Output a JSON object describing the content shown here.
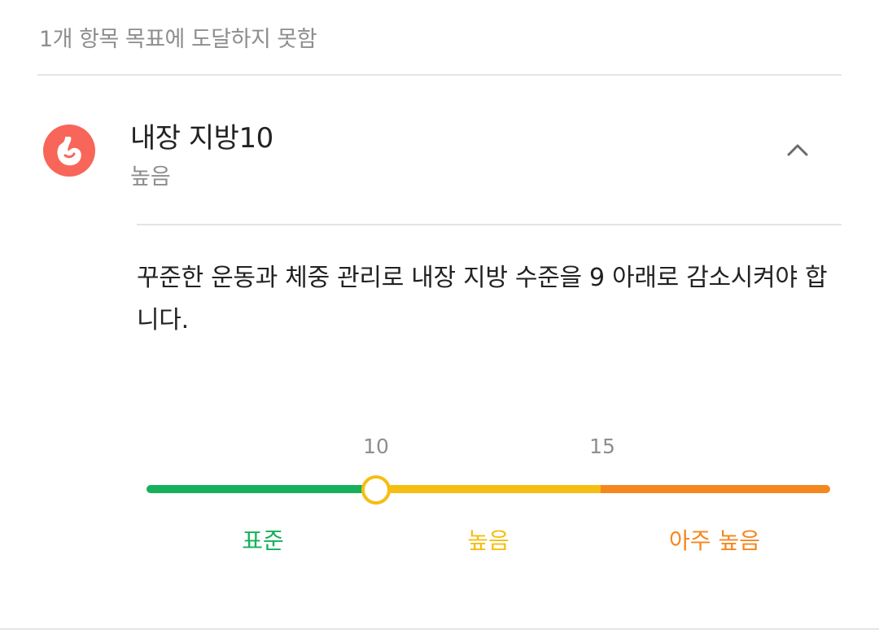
{
  "summary": {
    "text": "1개 항목 목표에 도달하지 못함"
  },
  "item": {
    "icon": "stomach-icon",
    "title": "내장 지방",
    "value": "10",
    "status": "높음",
    "expanded": true,
    "advice": "꾸준한 운동과 체중 관리로 내장 지방 수준을 9 아래로 감소시켜야 합니다."
  },
  "scale": {
    "current": 10,
    "min": 1,
    "max": 20,
    "thresholds": [
      "10",
      "15"
    ],
    "zones": [
      {
        "label": "표준",
        "color": "#16b05a"
      },
      {
        "label": "높음",
        "color": "#f4be12"
      },
      {
        "label": "아주 높음",
        "color": "#f5871f"
      }
    ]
  },
  "colors": {
    "icon_bg": "#f76659",
    "standard": "#16b05a",
    "high": "#f4be12",
    "very_high": "#f5871f"
  }
}
